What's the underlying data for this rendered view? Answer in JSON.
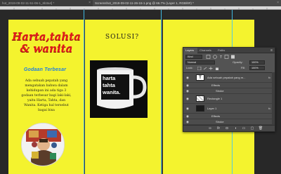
{
  "tabs": [
    {
      "label": "hot_2019-09-02-11-51-06-1_6b3a4] *"
    },
    {
      "label": "Screenshot_2019-09-02-11-26-15-1.png @ 66.7% (Layer 1, RGB/8#) *"
    }
  ],
  "tab_close": "×",
  "document": {
    "background_color": "#f4f32e",
    "headline": "Harta,tahta & wanita",
    "subhead": "Godaan Terbesar",
    "body": "Ada sebuah pepatah yang mengatakan bahwa dalam kehidupan ini ada tiga 3 godaan terbesar bagi laki-laki, yaitu Harta, Tahta, dan Wanita. Ketiga hal tersebut bagai bisa",
    "solusi": "SOLUSI?",
    "mug_text": [
      "harta",
      "tahta",
      "wanita."
    ]
  },
  "panel": {
    "tabs": [
      {
        "label": "Layers"
      },
      {
        "label": "Channels"
      },
      {
        "label": "Paths"
      }
    ],
    "menu_icon": "≡",
    "kind_label": "Kind",
    "blend_mode": "Normal",
    "opacity_label": "Opacity:",
    "opacity_value": "100%",
    "lock_label": "Lock:",
    "fill_label": "Fill:",
    "fill_value": "100%",
    "layers": [
      {
        "name": "Ada sebuah pepatah yang m...",
        "fx": "fx"
      },
      {
        "name": "Effects"
      },
      {
        "name": "Stroke"
      },
      {
        "name": "Rectangle 1"
      },
      {
        "name": "Layer 1",
        "fx": "fx"
      },
      {
        "name": "Effects"
      },
      {
        "name": "Stroke"
      }
    ]
  },
  "icons": {
    "eye": "eye-icon",
    "link": "link-icon",
    "fx": "fx-icon",
    "mask": "mask-icon",
    "adjustment": "adjustment-icon",
    "group": "folder-icon",
    "new_layer": "new-layer-icon",
    "trash": "trash-icon"
  },
  "colors": {
    "guide": "#42c6f2",
    "headline": "#e31b1b",
    "subhead": "#1f7ee0",
    "selected_layer": "#6a7fa0"
  }
}
